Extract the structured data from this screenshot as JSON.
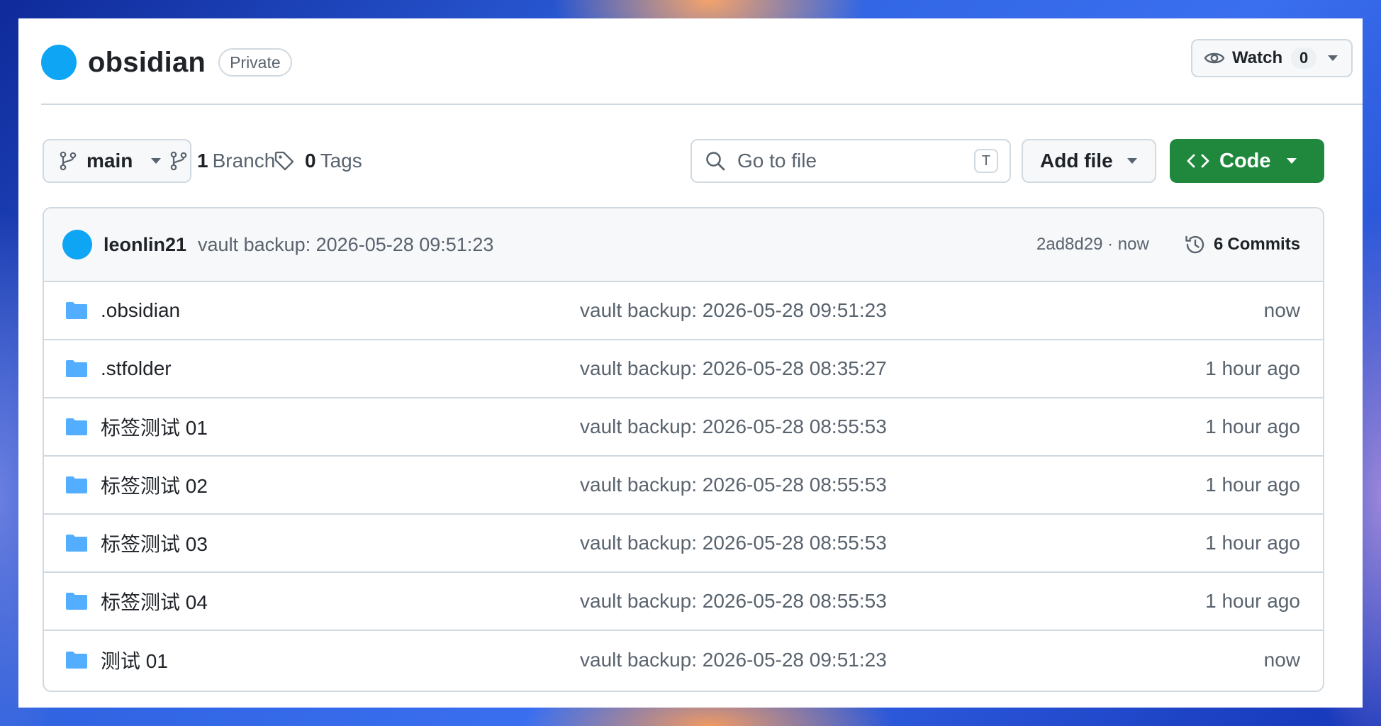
{
  "repo": {
    "name": "obsidian",
    "visibility": "Private",
    "avatar_color": "#0ea5f5"
  },
  "watch": {
    "label": "Watch",
    "count": "0",
    "icon": "eye-icon"
  },
  "toolbar": {
    "branch": "main",
    "branch_count": "1",
    "branch_label": "Branch",
    "tag_count": "0",
    "tag_label": "Tags",
    "goto_placeholder": "Go to file",
    "goto_shortcut": "T",
    "add_file_label": "Add file",
    "code_label": "Code"
  },
  "latest_commit": {
    "author": "leonlin21",
    "message": "vault backup: 2026-05-28 09:51:23",
    "sha_time": "2ad8d29 · now",
    "commits_count": "6",
    "commits_label": "Commits"
  },
  "files": [
    {
      "name": ".obsidian",
      "message": "vault backup: 2026-05-28 09:51:23",
      "age": "now"
    },
    {
      "name": ".stfolder",
      "message": "vault backup: 2026-05-28 08:35:27",
      "age": "1 hour ago"
    },
    {
      "name": "标签测试 01",
      "message": "vault backup: 2026-05-28 08:55:53",
      "age": "1 hour ago"
    },
    {
      "name": "标签测试 02",
      "message": "vault backup: 2026-05-28 08:55:53",
      "age": "1 hour ago"
    },
    {
      "name": "标签测试 03",
      "message": "vault backup: 2026-05-28 08:55:53",
      "age": "1 hour ago"
    },
    {
      "name": "标签测试 04",
      "message": "vault backup: 2026-05-28 08:55:53",
      "age": "1 hour ago"
    },
    {
      "name": "测试 01",
      "message": "vault backup: 2026-05-28 09:51:23",
      "age": "now"
    }
  ],
  "colors": {
    "folder": "#54aeff",
    "code_button": "#1f883d",
    "border": "#d1d9e0",
    "muted_text": "#59636e"
  }
}
